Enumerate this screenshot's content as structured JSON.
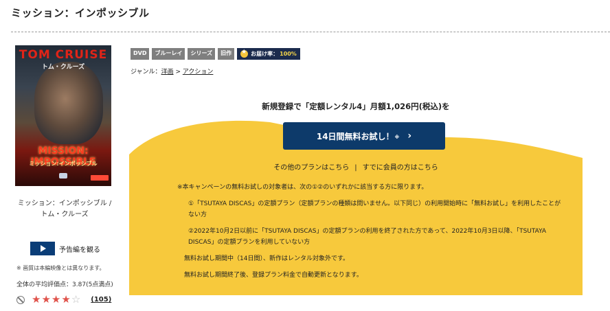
{
  "page_title": "ミッション：インポッシブル",
  "poster": {
    "actor_en": "TOM CRUISE",
    "actor_ja": "トム・クルーズ",
    "title_en": "MISSION: IMPOSSIBLE",
    "title_ja": "ミッション:インポッシブル"
  },
  "product_name": "ミッション：インポッシブル / トム・クルーズ",
  "trailer_label": "予告編を観る",
  "image_note": "※ 画質は本編映像とは異なります。",
  "rating": {
    "label": "全体の平均評価点：",
    "value": "3.87",
    "scale": "(5点満点)",
    "stars_filled": 4,
    "stars_total": 5,
    "review_count": "105"
  },
  "tags": [
    "DVD",
    "ブルーレイ",
    "シリーズ",
    "旧作"
  ],
  "delivery": {
    "label": "お届け率：",
    "value": "100%"
  },
  "genre": {
    "label": "ジャンル：",
    "items": [
      "洋画",
      "アクション"
    ],
    "sep": " > "
  },
  "campaign": {
    "headline": "新規登録で「定額レンタル4」月額1,026円(税込)を",
    "button_label": "14日間無料お試し！",
    "button_note": "※",
    "button_chevron": "›",
    "other_plans": "その他のプランはこちら",
    "separator": "|",
    "members": "すでに会員の方はこちら"
  },
  "notes": {
    "intro": "※本キャンペーンの無料お試しの対象者は、次の①②のいずれかに該当する方に限ります。",
    "item1": "①「TSUTAYA DISCAS」の定額プラン（定額プランの種類は問いません。以下同じ）の利用開始時に「無料お試し」を利用したことがない方",
    "item2": "②2022年10月2日以前に「TSUTAYA DISCAS」の定額プランの利用を終了された方であって、2022年10月3日以降、「TSUTAYA DISCAS」の定額プランを利用していない方",
    "period": "無料お試し期間中（14日間）、新作はレンタル対象外です。",
    "after": "無料お試し期間終了後、登録プラン料金で自動更新となります。"
  },
  "colors": {
    "cta_button": "#0d3a6a",
    "yellow": "#f7c93c",
    "tag_gray": "#7f7f7f",
    "star": "#e0524a"
  }
}
